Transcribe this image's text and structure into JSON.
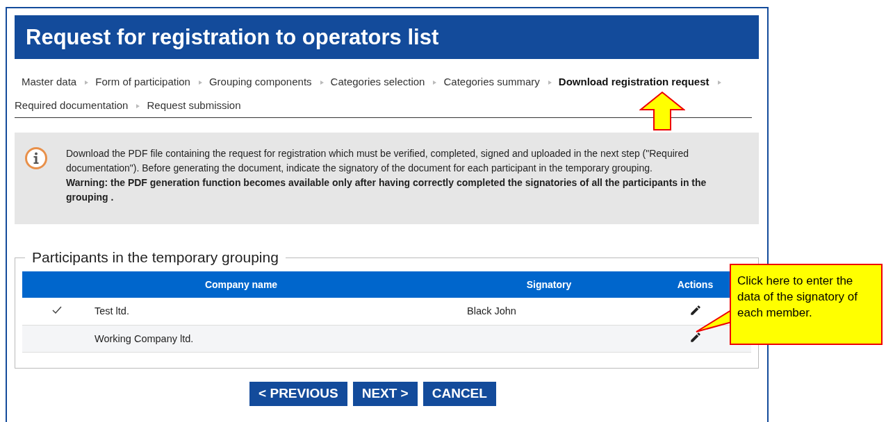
{
  "title": "Request for registration to operators list",
  "steps": [
    {
      "label": "Master data",
      "selected": false
    },
    {
      "label": "Form of participation",
      "selected": false
    },
    {
      "label": "Grouping components",
      "selected": false
    },
    {
      "label": "Categories selection",
      "selected": false
    },
    {
      "label": "Categories summary",
      "selected": false
    },
    {
      "label": "Download registration request",
      "selected": true
    },
    {
      "label": "Required documentation",
      "selected": false
    },
    {
      "label": "Request submission",
      "selected": false
    }
  ],
  "info": {
    "text": "Download the PDF file containing the request for registration which must be verified, completed, signed and uploaded in the next step (\"Required documentation\"). Before generating the document, indicate the signatory of the document for each participant in the temporary grouping.",
    "warning": "Warning: the PDF generation function becomes available only after having correctly completed the signatories of all the participants in the grouping ."
  },
  "participants": {
    "legend": "Participants in the temporary grouping",
    "columns": [
      "Company name",
      "Signatory",
      "Actions"
    ],
    "rows": [
      {
        "checked": true,
        "company": "Test ltd.",
        "signatory": "Black John"
      },
      {
        "checked": false,
        "company": "Working Company ltd."
      }
    ]
  },
  "buttons": [
    "< PREVIOUS",
    "NEXT >",
    "CANCEL"
  ],
  "callout": "Click here to enter the data of the signatory of each member."
}
